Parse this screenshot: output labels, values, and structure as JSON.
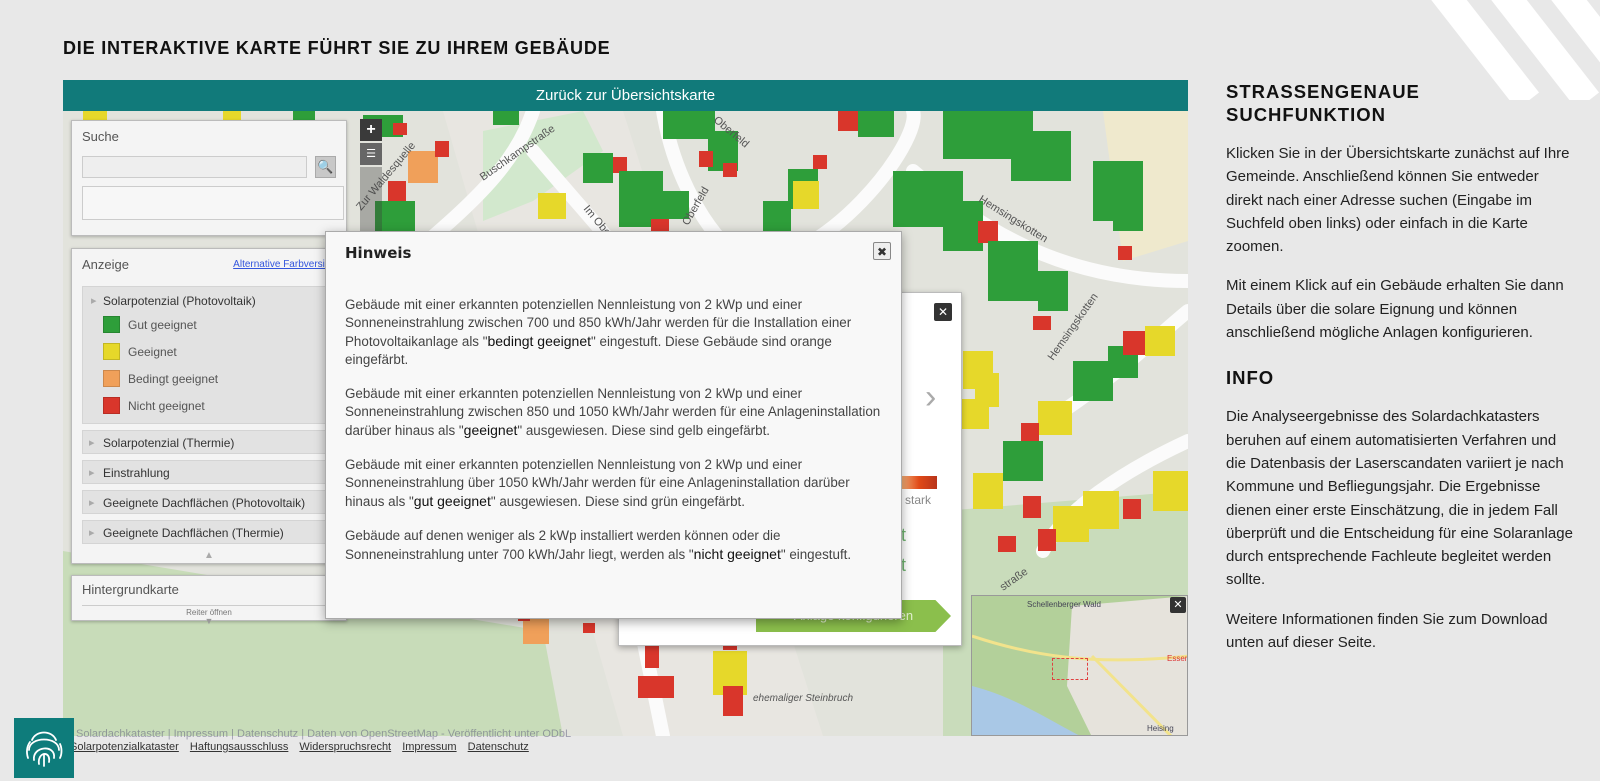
{
  "page": {
    "heading": "DIE INTERAKTIVE KARTE FÜHRT SIE ZU IHREM GEBÄUDE"
  },
  "map": {
    "back_label": "Zurück zur Übersichtskarte",
    "street_labels": [
      "Zur Waldesquelle",
      "Buschkampstraße",
      "Im Oberfeld",
      "Oberfeld",
      "Oberfeld",
      "Hemsingskotten",
      "Hemsingskotten",
      "ehemaliger Steinbruch",
      "straße"
    ]
  },
  "search_panel": {
    "title": "Suche",
    "input_value": "",
    "button_icon": "search-icon"
  },
  "layer_panel": {
    "title": "Anzeige",
    "alt_link": "Alternative Farbversion",
    "active_layer": "Solarpotenzial (Photovoltaik)",
    "legend": [
      {
        "label": "Gut geeignet",
        "color": "#2e9e3a"
      },
      {
        "label": "Geeignet",
        "color": "#e6d82a"
      },
      {
        "label": "Bedingt geeignet",
        "color": "#f0a05a"
      },
      {
        "label": "Nicht geeignet",
        "color": "#d9362b"
      }
    ],
    "other_layers": [
      "Solarpotenzial (Thermie)",
      "Einstrahlung",
      "Geeignete Dachflächen (Photovoltaik)",
      "Geeignete Dachflächen (Thermie)"
    ]
  },
  "background_panel": {
    "title": "Hintergrundkarte",
    "tab_label": "Reiter öffnen"
  },
  "info_popup": {
    "scale_label": "stark",
    "green_text": "t",
    "button_label": "Anlage konfigurieren"
  },
  "hinweis": {
    "title": "Hinweis",
    "paragraphs": [
      {
        "before": "Gebäude mit einer erkannten potenziellen Nennleistung von 2 kWp und einer Sonneneinstrahlung zwischen 700 und 850 kWh/Jahr werden für die Installation einer Photovoltaikanlage als \"",
        "bold": "bedingt geeignet",
        "after": "\" eingestuft. Diese Gebäude sind orange eingefärbt."
      },
      {
        "before": "Gebäude mit einer erkannten potenziellen Nennleistung von 2 kWp und einer Sonneneinstrahlung zwischen 850 und 1050 kWh/Jahr werden für eine Anlageninstallation darüber hinaus als \"",
        "bold": "geeignet",
        "after": "\" ausgewiesen. Diese sind gelb eingefärbt."
      },
      {
        "before": "Gebäude mit einer erkannten potenziellen Nennleistung von 2 kWp und einer Sonneneinstrahlung über 1050 kWh/Jahr werden für eine Anlageninstallation darüber hinaus als \"",
        "bold": "gut geeignet",
        "after": "\" ausgewiesen. Diese sind grün eingefärbt."
      },
      {
        "before": "Gebäude auf denen weniger als 2 kWp installiert werden können oder die Sonneneinstrahlung unter 700 kWh/Jahr liegt, werden als \"",
        "bold": "nicht geeignet",
        "after": "\" eingestuft."
      }
    ]
  },
  "minimap": {
    "labels": [
      "Schellenberger Wald",
      "Essen",
      "Heising"
    ]
  },
  "footer": {
    "attribution": "Solardachkataster | Impressum | Datenschutz | Daten von OpenStreetMap - Veröffentlicht unter ODbL",
    "links": [
      "Solarpotenzialkataster",
      "Haftungsausschluss",
      "Widerspruchsrecht",
      "Impressum",
      "Datenschutz"
    ]
  },
  "sidebar": {
    "h1": "STRASSENGENAUE SUCHFUNKTION",
    "p1": "Klicken Sie in der Übersichtskarte zunächst auf Ihre Gemeinde. Anschließend können Sie entweder direkt nach einer Adresse suchen (Eingabe im Suchfeld oben links) oder einfach in die Karte zoomen.",
    "p2": "Mit einem Klick auf ein Gebäude erhalten Sie dann Details über die solare Eignung und können anschließend mögliche Anlagen konfigurieren.",
    "h2": "INFO",
    "p3": "Die Analyseergebnisse des Solardachkatasters beruhen auf einem automatisierten Verfahren und die Datenbasis der Laserscandaten variiert je nach Kommune und Befliegungsjahr. Die Ergebnisse dienen einer erste Einschätzung, die in jedem Fall überprüft und die Entscheidung für eine Solaranlage durch entsprechende Fachleute begleitet werden sollte.",
    "p4": "Weitere Informationen finden Sie zum Download unten auf dieser Seite."
  }
}
